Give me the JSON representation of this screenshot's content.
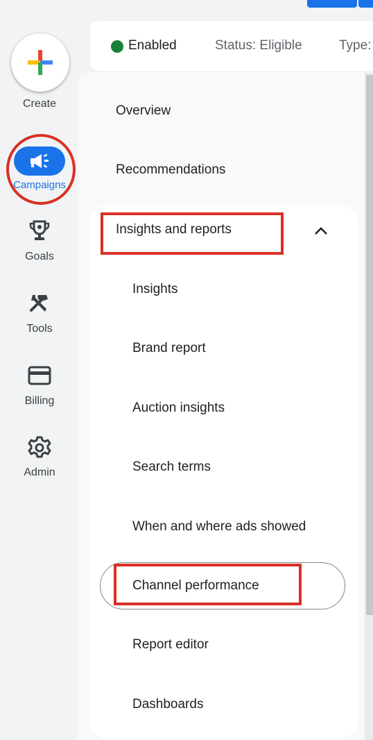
{
  "status_bar": {
    "status": "Enabled",
    "status_detail": "Status: Eligible",
    "type_label": "Type:",
    "status_color": "#188038"
  },
  "rail": {
    "create_label": "Create",
    "items": [
      {
        "label": "Campaigns",
        "icon": "megaphone-icon",
        "active": true
      },
      {
        "label": "Goals",
        "icon": "trophy-icon"
      },
      {
        "label": "Tools",
        "icon": "tools-icon"
      },
      {
        "label": "Billing",
        "icon": "credit-card-icon"
      },
      {
        "label": "Admin",
        "icon": "gear-icon"
      }
    ]
  },
  "nav": {
    "overview": "Overview",
    "recommendations": "Recommendations",
    "section": {
      "label": "Insights and reports",
      "expanded": true,
      "items": [
        "Insights",
        "Brand report",
        "Auction insights",
        "Search terms",
        "When and where ads showed",
        "Channel performance",
        "Report editor",
        "Dashboards"
      ],
      "selected": "Channel performance"
    }
  },
  "colors": {
    "accent": "#1a73e8",
    "highlight": "#d93025"
  }
}
